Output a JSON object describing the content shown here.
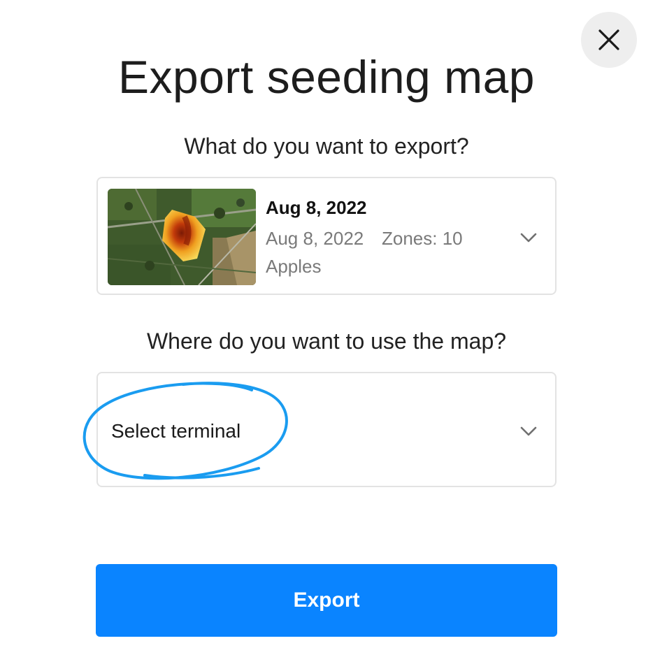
{
  "dialog": {
    "title": "Export seeding map",
    "close_icon": "close-icon"
  },
  "export_section": {
    "question": "What do you want to export?",
    "selected_map": {
      "title": "Aug 8, 2022",
      "date": "Aug 8, 2022",
      "zones": "Zones: 10",
      "crop": "Apples",
      "thumbnail_icon": "field-map-thumbnail"
    },
    "dropdown_icon": "chevron-down-icon"
  },
  "terminal_section": {
    "question": "Where do you want to use the map?",
    "placeholder": "Select terminal",
    "dropdown_icon": "chevron-down-icon",
    "annotation_color": "#1a9cf0"
  },
  "actions": {
    "export_label": "Export",
    "export_color": "#0a84ff"
  }
}
